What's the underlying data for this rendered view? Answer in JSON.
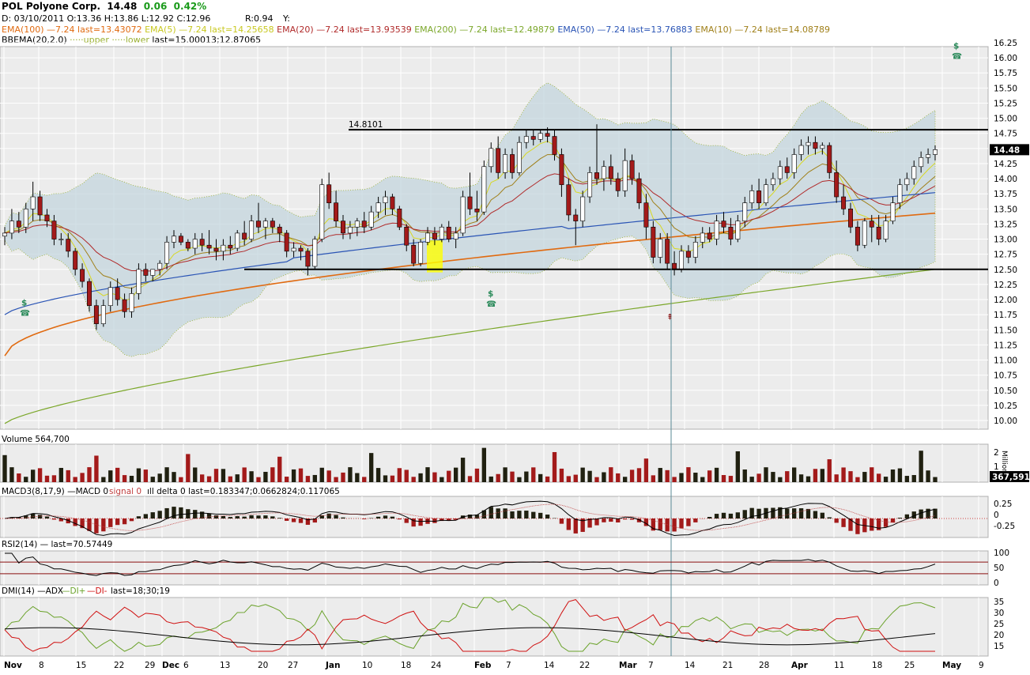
{
  "colors": {
    "up": "#ffffff",
    "down": "#a31a1a",
    "ema100": "#e06a10",
    "ema20": "#b02a2a",
    "ema200": "#7ba72a",
    "ema50": "#2a54b5",
    "ema10": "#a0801a",
    "ema5": "#d8d820",
    "bb": "#c4d6de",
    "rsi": "#8a1010",
    "diplus": "#6aa22a",
    "diminus": "#d01010",
    "adx": "#000000",
    "vol_up": "#202010",
    "vol_down": "#a31a1a",
    "bg": "#ececec"
  },
  "header": {
    "symbol": "POL Polyone Corp.",
    "last": "14.48",
    "change": "0.06",
    "pct": "0.42%",
    "ohlc": "D: 03/10/2011  O:13.36  H:13.86  L:12.92  C:12.96",
    "r": "R:0.94",
    "y": "Y:",
    "legend": [
      {
        "text": "EMA(100) —7.24 last=13.43072",
        "color": "#e06a10"
      },
      {
        "text": "EMA(5) —7.24 last=14.25658",
        "color": "#c8c820"
      },
      {
        "text": "EMA(20) —7.24 last=13.93539",
        "color": "#b02a2a"
      },
      {
        "text": "EMA(200) —7.24 last=12.49879",
        "color": "#7ba72a"
      },
      {
        "text": "EMA(50) —7.24 last=13.76883",
        "color": "#2a54b5"
      },
      {
        "text": "EMA(10) —7.24 last=14.08789",
        "color": "#a0801a"
      }
    ],
    "bb": "BBEMA(20,2.0)",
    "bb_upper": "upper",
    "bb_lower": "lower",
    "bb_last": "last=15.00013;12.87065"
  },
  "panels": {
    "volume_title": "Volume 564,700",
    "volume_last": "367,591",
    "volume_unit": "Millions",
    "macd_title_a": "MACD3(8,17,9) —MACD 0",
    "macd_title_b": "signal 0",
    "macd_title_c": "ıll delta 0 last=0.183347;0.0662824;0.117065",
    "rsi_title": "RSI2(14)  — last=70.57449",
    "dmi_title_a": "DMI(14)  —ADX",
    "dmi_title_b": "—DI+",
    "dmi_title_c": "—DI-",
    "dmi_title_d": "last=18;30;19"
  },
  "chart_data": {
    "type": "candlestick",
    "price_axis": {
      "min": 10.0,
      "max": 16.25,
      "ticks": [
        "16.25",
        "16.00",
        "15.75",
        "15.50",
        "15.25",
        "15.00",
        "14.75",
        "14.50",
        "14.25",
        "14.00",
        "13.75",
        "13.50",
        "13.25",
        "13.00",
        "12.75",
        "12.50",
        "12.25",
        "12.00",
        "11.75",
        "11.50",
        "11.25",
        "11.00",
        "10.75",
        "10.50",
        "10.25",
        "10.00"
      ]
    },
    "last_price_label": "14.48",
    "resistance": {
      "value": 14.81,
      "label": "14.8101"
    },
    "support": {
      "value": 12.5
    },
    "x_labels": [
      "Nov",
      "8",
      "15",
      "22",
      "29",
      "Dec",
      "6",
      "13",
      "20",
      "27",
      "Jan",
      "10",
      "18",
      "24",
      "Feb",
      "7",
      "14",
      "22",
      "Mar",
      "7",
      "14",
      "21",
      "28",
      "Apr",
      "11",
      "18",
      "25",
      "May",
      "9"
    ],
    "candles": [
      [
        13.05,
        13.2,
        12.9,
        13.1
      ],
      [
        13.1,
        13.5,
        13.0,
        13.3
      ],
      [
        13.3,
        13.45,
        13.1,
        13.2
      ],
      [
        13.2,
        13.6,
        13.1,
        13.5
      ],
      [
        13.5,
        13.95,
        13.3,
        13.7
      ],
      [
        13.7,
        13.8,
        13.3,
        13.4
      ],
      [
        13.4,
        13.5,
        13.2,
        13.3
      ],
      [
        13.3,
        13.4,
        12.9,
        13.0
      ],
      [
        13.0,
        13.1,
        12.9,
        13.0
      ],
      [
        13.0,
        13.1,
        12.7,
        12.8
      ],
      [
        12.8,
        12.85,
        12.4,
        12.5
      ],
      [
        12.5,
        12.6,
        12.2,
        12.3
      ],
      [
        12.3,
        12.35,
        11.8,
        11.9
      ],
      [
        11.9,
        12.0,
        11.5,
        11.6
      ],
      [
        11.6,
        12.0,
        11.55,
        11.9
      ],
      [
        11.9,
        12.3,
        11.8,
        12.2
      ],
      [
        12.2,
        12.35,
        11.9,
        12.0
      ],
      [
        12.0,
        12.1,
        11.7,
        11.8
      ],
      [
        11.8,
        12.2,
        11.7,
        12.1
      ],
      [
        12.1,
        12.6,
        12.0,
        12.5
      ],
      [
        12.5,
        12.6,
        12.3,
        12.4
      ],
      [
        12.4,
        12.5,
        12.3,
        12.5
      ],
      [
        12.5,
        12.65,
        12.4,
        12.6
      ],
      [
        12.6,
        13.05,
        12.5,
        12.95
      ],
      [
        12.95,
        13.15,
        12.85,
        13.05
      ],
      [
        13.05,
        13.1,
        12.9,
        12.95
      ],
      [
        12.95,
        13.0,
        12.8,
        12.85
      ],
      [
        12.85,
        13.1,
        12.75,
        13.0
      ],
      [
        13.0,
        13.1,
        12.8,
        12.9
      ],
      [
        12.9,
        13.15,
        12.75,
        12.85
      ],
      [
        12.85,
        13.0,
        12.65,
        12.8
      ],
      [
        12.8,
        13.0,
        12.65,
        12.9
      ],
      [
        12.9,
        13.05,
        12.75,
        12.85
      ],
      [
        12.85,
        13.15,
        12.8,
        13.1
      ],
      [
        13.1,
        13.3,
        12.9,
        13.0
      ],
      [
        13.0,
        13.4,
        12.95,
        13.3
      ],
      [
        13.3,
        13.6,
        13.1,
        13.2
      ],
      [
        13.2,
        13.35,
        13.0,
        13.3
      ],
      [
        13.3,
        13.35,
        13.1,
        13.2
      ],
      [
        13.2,
        13.25,
        12.95,
        13.1
      ],
      [
        13.1,
        13.15,
        12.7,
        12.8
      ],
      [
        12.8,
        12.95,
        12.7,
        12.85
      ],
      [
        12.85,
        12.9,
        12.65,
        12.8
      ],
      [
        12.8,
        12.85,
        12.4,
        12.55
      ],
      [
        12.55,
        13.05,
        12.5,
        13.0
      ],
      [
        13.0,
        14.0,
        12.95,
        13.9
      ],
      [
        13.9,
        14.1,
        13.5,
        13.6
      ],
      [
        13.6,
        13.8,
        13.2,
        13.3
      ],
      [
        13.3,
        13.4,
        13.0,
        13.1
      ],
      [
        13.1,
        13.3,
        13.0,
        13.2
      ],
      [
        13.2,
        13.35,
        13.05,
        13.3
      ],
      [
        13.3,
        13.45,
        13.1,
        13.2
      ],
      [
        13.2,
        13.55,
        13.15,
        13.45
      ],
      [
        13.45,
        13.7,
        13.35,
        13.6
      ],
      [
        13.6,
        13.8,
        13.4,
        13.7
      ],
      [
        13.7,
        13.75,
        13.4,
        13.5
      ],
      [
        13.5,
        13.55,
        13.15,
        13.2
      ],
      [
        13.2,
        13.25,
        12.8,
        12.9
      ],
      [
        12.9,
        13.0,
        12.55,
        12.6
      ],
      [
        12.6,
        13.0,
        12.55,
        12.95
      ],
      [
        12.95,
        13.2,
        12.9,
        13.1
      ],
      [
        13.1,
        13.2,
        12.9,
        13.0
      ],
      [
        13.0,
        13.25,
        12.95,
        13.2
      ],
      [
        13.2,
        13.3,
        12.95,
        13.0
      ],
      [
        13.0,
        13.2,
        12.85,
        13.1
      ],
      [
        13.1,
        13.8,
        13.05,
        13.7
      ],
      [
        13.7,
        14.1,
        13.4,
        13.5
      ],
      [
        13.5,
        13.8,
        13.3,
        13.45
      ],
      [
        13.45,
        14.3,
        13.4,
        14.2
      ],
      [
        14.2,
        14.6,
        14.1,
        14.5
      ],
      [
        14.5,
        14.7,
        14.0,
        14.1
      ],
      [
        14.1,
        14.5,
        14.0,
        14.4
      ],
      [
        14.4,
        14.5,
        14.0,
        14.1
      ],
      [
        14.1,
        14.7,
        14.05,
        14.6
      ],
      [
        14.6,
        14.8,
        14.5,
        14.7
      ],
      [
        14.7,
        14.8,
        14.55,
        14.65
      ],
      [
        14.65,
        14.8,
        14.6,
        14.75
      ],
      [
        14.75,
        14.85,
        14.6,
        14.7
      ],
      [
        14.7,
        14.8,
        14.3,
        14.4
      ],
      [
        14.4,
        14.5,
        13.7,
        13.9
      ],
      [
        13.9,
        14.0,
        13.3,
        13.4
      ],
      [
        13.4,
        13.5,
        12.9,
        13.3
      ],
      [
        13.3,
        13.8,
        13.2,
        13.7
      ],
      [
        13.7,
        14.2,
        13.6,
        14.1
      ],
      [
        14.1,
        14.9,
        13.9,
        14.0
      ],
      [
        14.0,
        14.3,
        13.8,
        14.2
      ],
      [
        14.2,
        14.4,
        13.9,
        14.0
      ],
      [
        14.0,
        14.1,
        13.7,
        13.8
      ],
      [
        13.8,
        14.5,
        13.7,
        14.3
      ],
      [
        14.3,
        14.4,
        13.9,
        14.0
      ],
      [
        14.0,
        14.1,
        13.5,
        13.6
      ],
      [
        13.6,
        13.75,
        13.0,
        13.2
      ],
      [
        13.2,
        13.3,
        12.6,
        12.7
      ],
      [
        12.7,
        13.1,
        12.6,
        13.0
      ],
      [
        13.0,
        13.1,
        12.5,
        12.6
      ],
      [
        12.6,
        12.8,
        12.4,
        12.5
      ],
      [
        12.5,
        12.9,
        12.45,
        12.8
      ],
      [
        12.8,
        12.9,
        12.6,
        12.7
      ],
      [
        12.7,
        13.05,
        12.6,
        12.95
      ],
      [
        12.95,
        13.2,
        12.85,
        13.1
      ],
      [
        13.1,
        13.2,
        12.95,
        13.0
      ],
      [
        13.0,
        13.4,
        12.9,
        13.3
      ],
      [
        13.3,
        13.45,
        13.1,
        13.2
      ],
      [
        13.2,
        13.35,
        12.9,
        13.0
      ],
      [
        13.0,
        13.4,
        12.95,
        13.3
      ],
      [
        13.3,
        13.7,
        13.2,
        13.6
      ],
      [
        13.6,
        13.9,
        13.5,
        13.8
      ],
      [
        13.8,
        14.0,
        13.5,
        13.6
      ],
      [
        13.6,
        14.0,
        13.55,
        13.9
      ],
      [
        13.9,
        14.1,
        13.8,
        14.0
      ],
      [
        14.0,
        14.3,
        13.9,
        14.2
      ],
      [
        14.2,
        14.35,
        14.0,
        14.1
      ],
      [
        14.1,
        14.5,
        14.0,
        14.4
      ],
      [
        14.4,
        14.65,
        14.3,
        14.55
      ],
      [
        14.55,
        14.7,
        14.4,
        14.6
      ],
      [
        14.6,
        14.7,
        14.4,
        14.5
      ],
      [
        14.5,
        14.6,
        14.4,
        14.55
      ],
      [
        14.55,
        14.6,
        14.0,
        14.1
      ],
      [
        14.1,
        14.3,
        13.6,
        13.7
      ],
      [
        13.7,
        13.9,
        13.4,
        13.5
      ],
      [
        13.5,
        13.6,
        13.1,
        13.2
      ],
      [
        13.2,
        13.3,
        12.8,
        12.9
      ],
      [
        12.9,
        13.35,
        12.85,
        13.3
      ],
      [
        13.3,
        13.4,
        12.95,
        13.2
      ],
      [
        13.2,
        13.4,
        12.9,
        13.0
      ],
      [
        13.0,
        13.4,
        12.95,
        13.3
      ],
      [
        13.3,
        13.7,
        13.25,
        13.6
      ],
      [
        13.6,
        14.0,
        13.5,
        13.9
      ],
      [
        13.9,
        14.1,
        13.8,
        14.0
      ],
      [
        14.0,
        14.3,
        13.9,
        14.2
      ],
      [
        14.2,
        14.45,
        14.1,
        14.35
      ],
      [
        14.35,
        14.5,
        14.25,
        14.4
      ],
      [
        14.4,
        14.55,
        14.3,
        14.48
      ]
    ],
    "volume_axis": {
      "ticks": [
        "2",
        "1"
      ]
    },
    "macd_axis": {
      "ticks": [
        "0.25",
        "0",
        "-0.25"
      ]
    },
    "rsi_axis": {
      "ticks": [
        "100",
        "50",
        "0"
      ]
    },
    "dmi_axis": {
      "ticks": [
        "35",
        "30",
        "25",
        "20",
        "15"
      ]
    }
  }
}
